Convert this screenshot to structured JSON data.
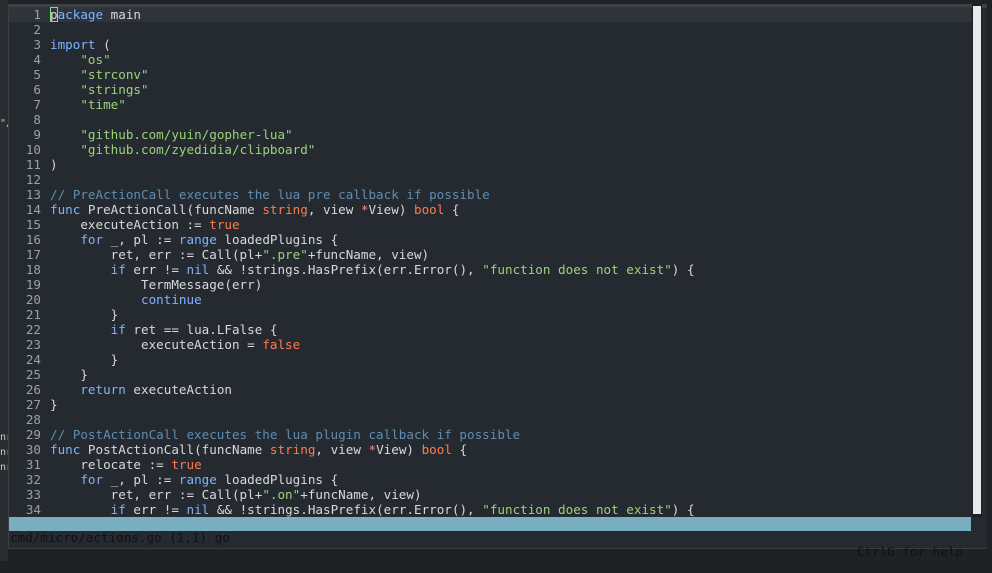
{
  "background_fragments": [
    "\"/",
    "nr",
    "nr",
    "nr"
  ],
  "editor": {
    "lines": [
      {
        "n": "1",
        "cursor": true,
        "parts": [
          {
            "t": "p"
          },
          {
            "t": "ackage",
            "c": "kw"
          },
          {
            "t": " main"
          }
        ]
      },
      {
        "n": "2",
        "parts": []
      },
      {
        "n": "3",
        "parts": [
          {
            "t": "import",
            "c": "kw"
          },
          {
            "t": " ("
          }
        ]
      },
      {
        "n": "4",
        "parts": [
          {
            "t": "    "
          },
          {
            "t": "\"os\"",
            "c": "st"
          }
        ]
      },
      {
        "n": "5",
        "parts": [
          {
            "t": "    "
          },
          {
            "t": "\"strconv\"",
            "c": "st"
          }
        ]
      },
      {
        "n": "6",
        "parts": [
          {
            "t": "    "
          },
          {
            "t": "\"strings\"",
            "c": "st"
          }
        ]
      },
      {
        "n": "7",
        "parts": [
          {
            "t": "    "
          },
          {
            "t": "\"time\"",
            "c": "st"
          }
        ]
      },
      {
        "n": "8",
        "parts": []
      },
      {
        "n": "9",
        "parts": [
          {
            "t": "    "
          },
          {
            "t": "\"github.com/yuin/gopher-lua\"",
            "c": "st"
          }
        ]
      },
      {
        "n": "10",
        "parts": [
          {
            "t": "    "
          },
          {
            "t": "\"github.com/zyedidia/clipboard\"",
            "c": "st"
          }
        ]
      },
      {
        "n": "11",
        "parts": [
          {
            "t": ")"
          }
        ]
      },
      {
        "n": "12",
        "parts": []
      },
      {
        "n": "13",
        "parts": [
          {
            "t": "// PreActionCall executes the lua pre callback if possible",
            "c": "cm"
          }
        ]
      },
      {
        "n": "14",
        "parts": [
          {
            "t": "func",
            "c": "kw"
          },
          {
            "t": " PreActionCall(funcName "
          },
          {
            "t": "string",
            "c": "tp"
          },
          {
            "t": ", view "
          },
          {
            "t": "*",
            "c": "op"
          },
          {
            "t": "View) "
          },
          {
            "t": "bool",
            "c": "tp"
          },
          {
            "t": " {"
          }
        ]
      },
      {
        "n": "15",
        "parts": [
          {
            "t": "    executeAction := "
          },
          {
            "t": "true",
            "c": "tp"
          }
        ]
      },
      {
        "n": "16",
        "parts": [
          {
            "t": "    "
          },
          {
            "t": "for",
            "c": "kw"
          },
          {
            "t": " _, pl := "
          },
          {
            "t": "range",
            "c": "kw"
          },
          {
            "t": " loadedPlugins {"
          }
        ]
      },
      {
        "n": "17",
        "parts": [
          {
            "t": "        ret, err := Call(pl+"
          },
          {
            "t": "\".pre\"",
            "c": "st"
          },
          {
            "t": "+funcName, view)"
          }
        ]
      },
      {
        "n": "18",
        "parts": [
          {
            "t": "        "
          },
          {
            "t": "if",
            "c": "kw"
          },
          {
            "t": " err != "
          },
          {
            "t": "nil",
            "c": "kw"
          },
          {
            "t": " && !strings.HasPrefix(err.Error(), "
          },
          {
            "t": "\"function does not exist\"",
            "c": "st"
          },
          {
            "t": ") {"
          }
        ]
      },
      {
        "n": "19",
        "parts": [
          {
            "t": "            TermMessage(err)"
          }
        ]
      },
      {
        "n": "20",
        "parts": [
          {
            "t": "            "
          },
          {
            "t": "continue",
            "c": "kw"
          }
        ]
      },
      {
        "n": "21",
        "parts": [
          {
            "t": "        }"
          }
        ]
      },
      {
        "n": "22",
        "parts": [
          {
            "t": "        "
          },
          {
            "t": "if",
            "c": "kw"
          },
          {
            "t": " ret == lua.LFalse {"
          }
        ]
      },
      {
        "n": "23",
        "parts": [
          {
            "t": "            executeAction = "
          },
          {
            "t": "false",
            "c": "tp"
          }
        ]
      },
      {
        "n": "24",
        "parts": [
          {
            "t": "        }"
          }
        ]
      },
      {
        "n": "25",
        "parts": [
          {
            "t": "    }"
          }
        ]
      },
      {
        "n": "26",
        "parts": [
          {
            "t": "    "
          },
          {
            "t": "return",
            "c": "kw"
          },
          {
            "t": " executeAction"
          }
        ]
      },
      {
        "n": "27",
        "parts": [
          {
            "t": "}"
          }
        ]
      },
      {
        "n": "28",
        "parts": []
      },
      {
        "n": "29",
        "parts": [
          {
            "t": "// PostActionCall executes the lua plugin callback if possible",
            "c": "cm"
          }
        ]
      },
      {
        "n": "30",
        "parts": [
          {
            "t": "func",
            "c": "kw"
          },
          {
            "t": " PostActionCall(funcName "
          },
          {
            "t": "string",
            "c": "tp"
          },
          {
            "t": ", view "
          },
          {
            "t": "*",
            "c": "op"
          },
          {
            "t": "View) "
          },
          {
            "t": "bool",
            "c": "tp"
          },
          {
            "t": " {"
          }
        ]
      },
      {
        "n": "31",
        "parts": [
          {
            "t": "    relocate := "
          },
          {
            "t": "true",
            "c": "tp"
          }
        ]
      },
      {
        "n": "32",
        "parts": [
          {
            "t": "    "
          },
          {
            "t": "for",
            "c": "kw"
          },
          {
            "t": " _, pl := "
          },
          {
            "t": "range",
            "c": "kw"
          },
          {
            "t": " loadedPlugins {"
          }
        ]
      },
      {
        "n": "33",
        "parts": [
          {
            "t": "        ret, err := Call(pl+"
          },
          {
            "t": "\".on\"",
            "c": "st"
          },
          {
            "t": "+funcName, view)"
          }
        ]
      },
      {
        "n": "34",
        "parts": [
          {
            "t": "        "
          },
          {
            "t": "if",
            "c": "kw"
          },
          {
            "t": " err != "
          },
          {
            "t": "nil",
            "c": "kw"
          },
          {
            "t": " && !strings.HasPrefix(err.Error(), "
          },
          {
            "t": "\"function does not exist\"",
            "c": "st"
          },
          {
            "t": ") {"
          }
        ]
      }
    ]
  },
  "statusbar": {
    "left": "cmd/micro/actions.go (1,1) go",
    "right": "CtrlG for help"
  },
  "colors": {
    "background": "#252a30",
    "keyword": "#7fb2ff",
    "type_constant": "#ff7a50",
    "string": "#9bd37a",
    "comment": "#5e8db0",
    "statusbar": "#78aebf"
  }
}
